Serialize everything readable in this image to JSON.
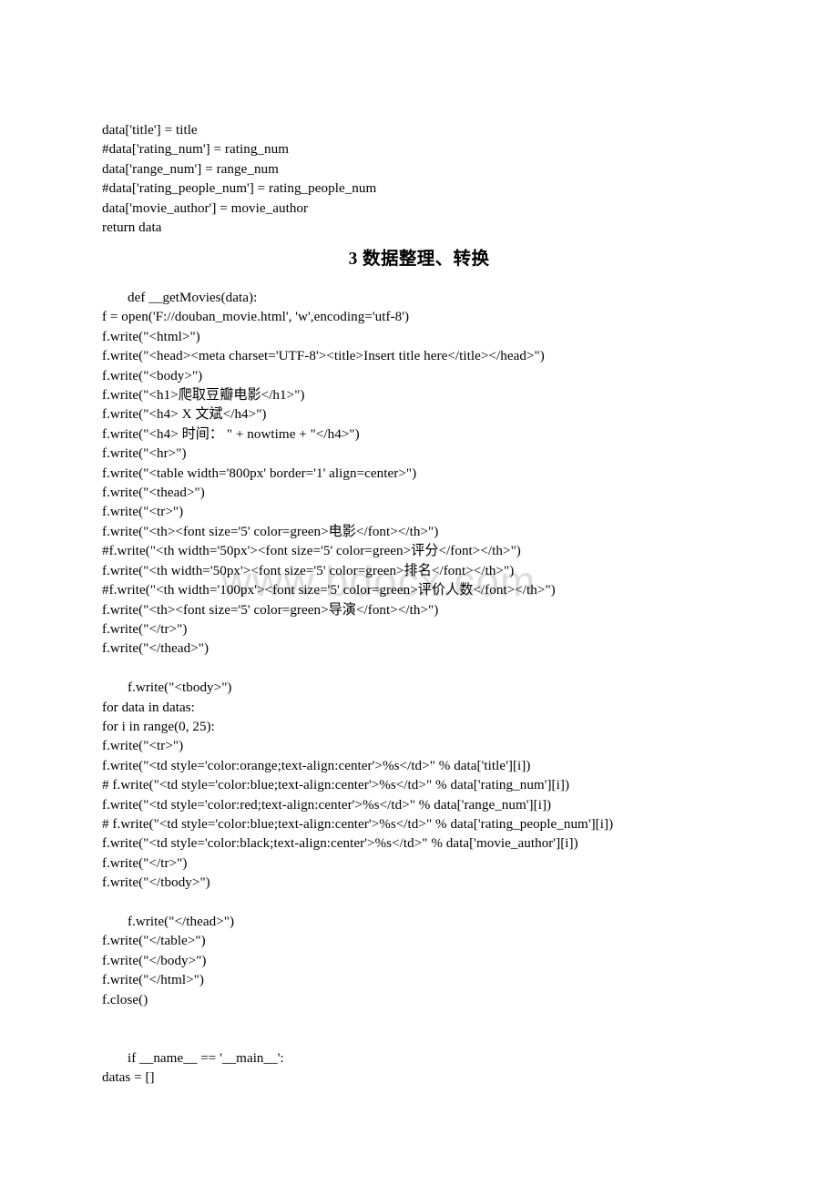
{
  "document": {
    "watermark": "www.bdocx.com",
    "heading": "3 数据整理、转换",
    "block_1": [
      "data['title'] = title",
      "#data['rating_num'] = rating_num",
      "data['range_num'] = range_num",
      "#data['rating_people_num'] = rating_people_num",
      "data['movie_author'] = movie_author",
      "return data"
    ],
    "block_2": [
      "    def __getMovies(data):",
      "f = open('F://douban_movie.html', 'w',encoding='utf-8')",
      "f.write(\"<html>\")",
      "f.write(\"<head><meta charset='UTF-8'><title>Insert title here</title></head>\")",
      "f.write(\"<body>\")",
      "f.write(\"<h1>爬取豆瓣电影</h1>\")",
      "f.write(\"<h4> X 文斌</h4>\")",
      "f.write(\"<h4> 时间： \" + nowtime + \"</h4>\")",
      "f.write(\"<hr>\")",
      "f.write(\"<table width='800px' border='1' align=center>\")",
      "f.write(\"<thead>\")",
      "f.write(\"<tr>\")",
      "f.write(\"<th><font size='5' color=green>电影</font></th>\")",
      "#f.write(\"<th width='50px'><font size='5' color=green>评分</font></th>\")",
      "f.write(\"<th width='50px'><font size='5' color=green>排名</font></th>\")",
      "#f.write(\"<th width='100px'><font size='5' color=green>评价人数</font></th>\")",
      "f.write(\"<th><font size='5' color=green>导演</font></th>\")",
      "f.write(\"</tr>\")",
      "f.write(\"</thead>\")",
      "",
      "    f.write(\"<tbody>\")",
      "for data in datas:",
      "for i in range(0, 25):",
      "f.write(\"<tr>\")",
      "f.write(\"<td style='color:orange;text-align:center'>%s</td>\" % data['title'][i])",
      "# f.write(\"<td style='color:blue;text-align:center'>%s</td>\" % data['rating_num'][i])",
      "f.write(\"<td style='color:red;text-align:center'>%s</td>\" % data['range_num'][i])",
      "# f.write(\"<td style='color:blue;text-align:center'>%s</td>\" % data['rating_people_num'][i])",
      "f.write(\"<td style='color:black;text-align:center'>%s</td>\" % data['movie_author'][i])",
      "f.write(\"</tr>\")",
      "f.write(\"</tbody>\")",
      "",
      "    f.write(\"</thead>\")",
      "f.write(\"</table>\")",
      "f.write(\"</body>\")",
      "f.write(\"</html>\")",
      "f.close()",
      "",
      "",
      "    if __name__ == '__main__':",
      "datas = []"
    ]
  }
}
